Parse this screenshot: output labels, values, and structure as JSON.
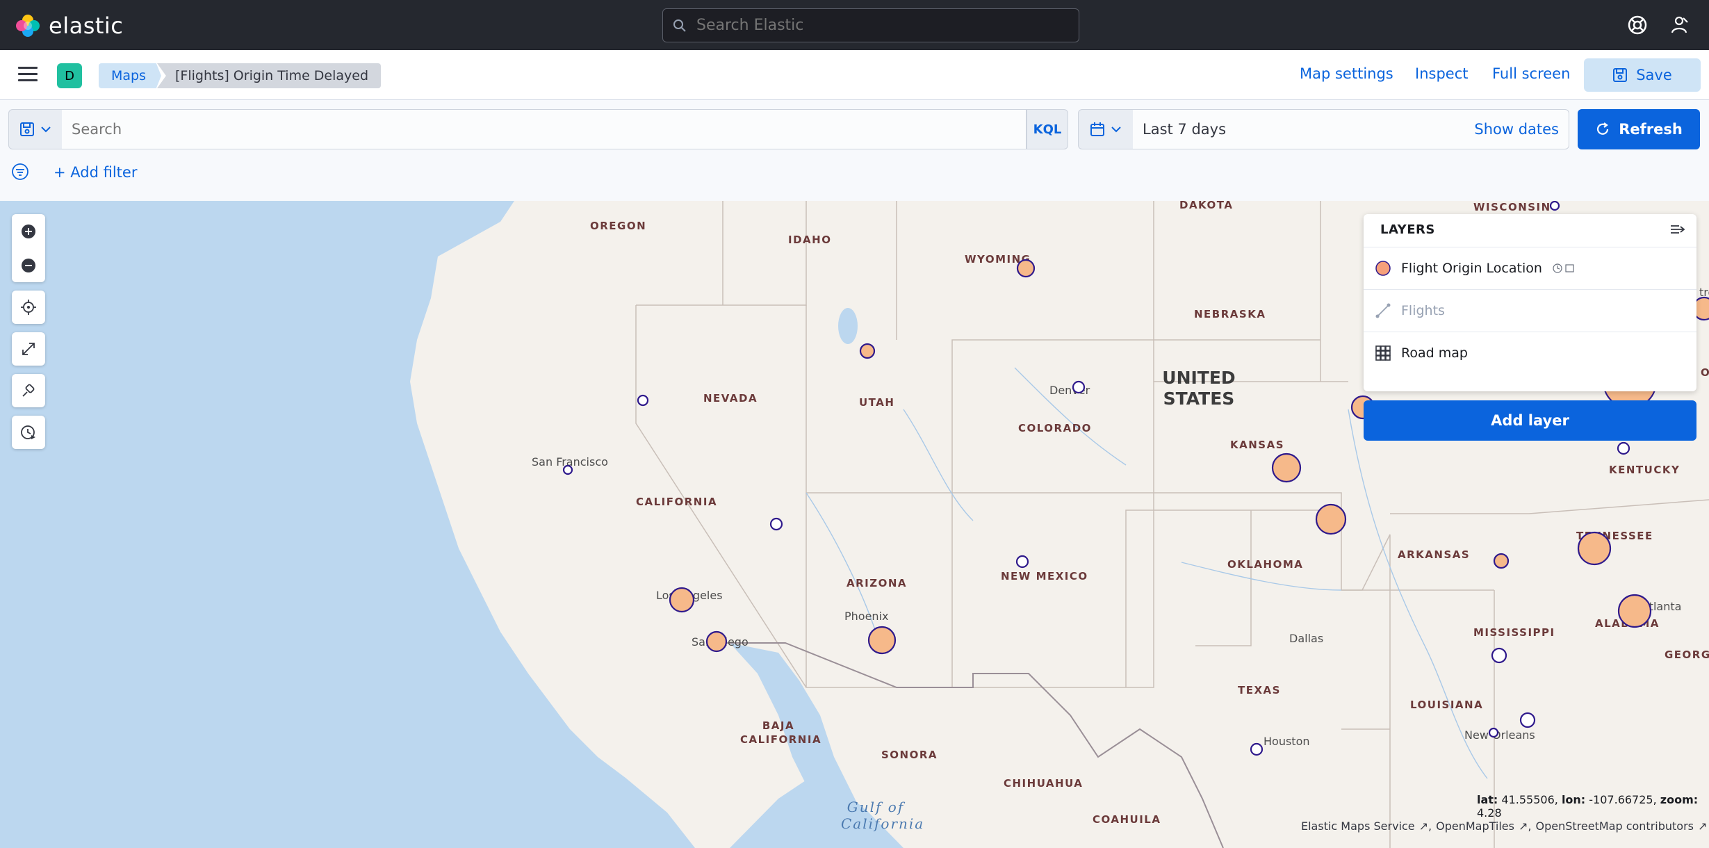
{
  "app": {
    "logo_text": "elastic"
  },
  "global_search": {
    "placeholder": "Search Elastic"
  },
  "appbar": {
    "space_initial": "D",
    "breadcrumbs": [
      "Maps",
      "[Flights] Origin Time Delayed"
    ],
    "links": {
      "map_settings": "Map settings",
      "inspect": "Inspect",
      "full_screen": "Full screen"
    },
    "save_label": "Save"
  },
  "query": {
    "placeholder": "Search",
    "language": "KQL",
    "time_range": "Last 7 days",
    "show_dates": "Show dates",
    "refresh_label": "Refresh",
    "add_filter": "+ Add filter"
  },
  "colors": {
    "accent": "#0b64dd",
    "header_bg": "#25282f",
    "water": "#bcd7ef",
    "land": "#f4f1ec",
    "point_fill": "#f6b98a",
    "point_stroke": "#2f1a8c"
  },
  "map": {
    "state_labels": [
      "OREGON",
      "IDAHO",
      "WYOMING",
      "DAKOTA",
      "WISCONSIN",
      "NEBRASKA",
      "NEVADA",
      "UTAH",
      "COLORADO",
      "KANSAS",
      "CALIFORNIA",
      "ARIZONA",
      "NEW MEXICO",
      "OKLAHOMA",
      "ARKANSAS",
      "KENTUCKY",
      "TENNESSEE",
      "MISSISSIPPI",
      "ALABAMA",
      "TEXAS",
      "LOUISIANA",
      "BAJA CALIFORNIA",
      "SONORA",
      "CHIHUAHUA",
      "COAHUILA",
      "GEORG"
    ],
    "city_labels": [
      "San Francisco",
      "Los Angeles",
      "San Diego",
      "Phoenix",
      "Denver",
      "Dallas",
      "Houston",
      "New Orleans",
      "Atlanta"
    ],
    "country_label": "UNITED STATES",
    "water_label": "Gulf of California",
    "edge_fragments": [
      "tro",
      "OH"
    ],
    "coordinates": {
      "lat_label": "lat:",
      "lat": "41.55506",
      "lon_label": "lon:",
      "lon": "-107.66725",
      "zoom_label": "zoom:",
      "zoom": "4.28"
    },
    "attribution": [
      "Elastic Maps Service",
      "OpenMapTiles",
      "OpenStreetMap contributors"
    ]
  },
  "layers": {
    "title": "LAYERS",
    "items": [
      {
        "name": "Flight Origin Location",
        "icon": "circle-swatch-icon",
        "enabled": true
      },
      {
        "name": "Flights",
        "icon": "line-layer-icon",
        "enabled": false
      },
      {
        "name": "Road map",
        "icon": "grid-tiles-icon",
        "enabled": true
      }
    ],
    "add_layer_label": "Add layer"
  }
}
